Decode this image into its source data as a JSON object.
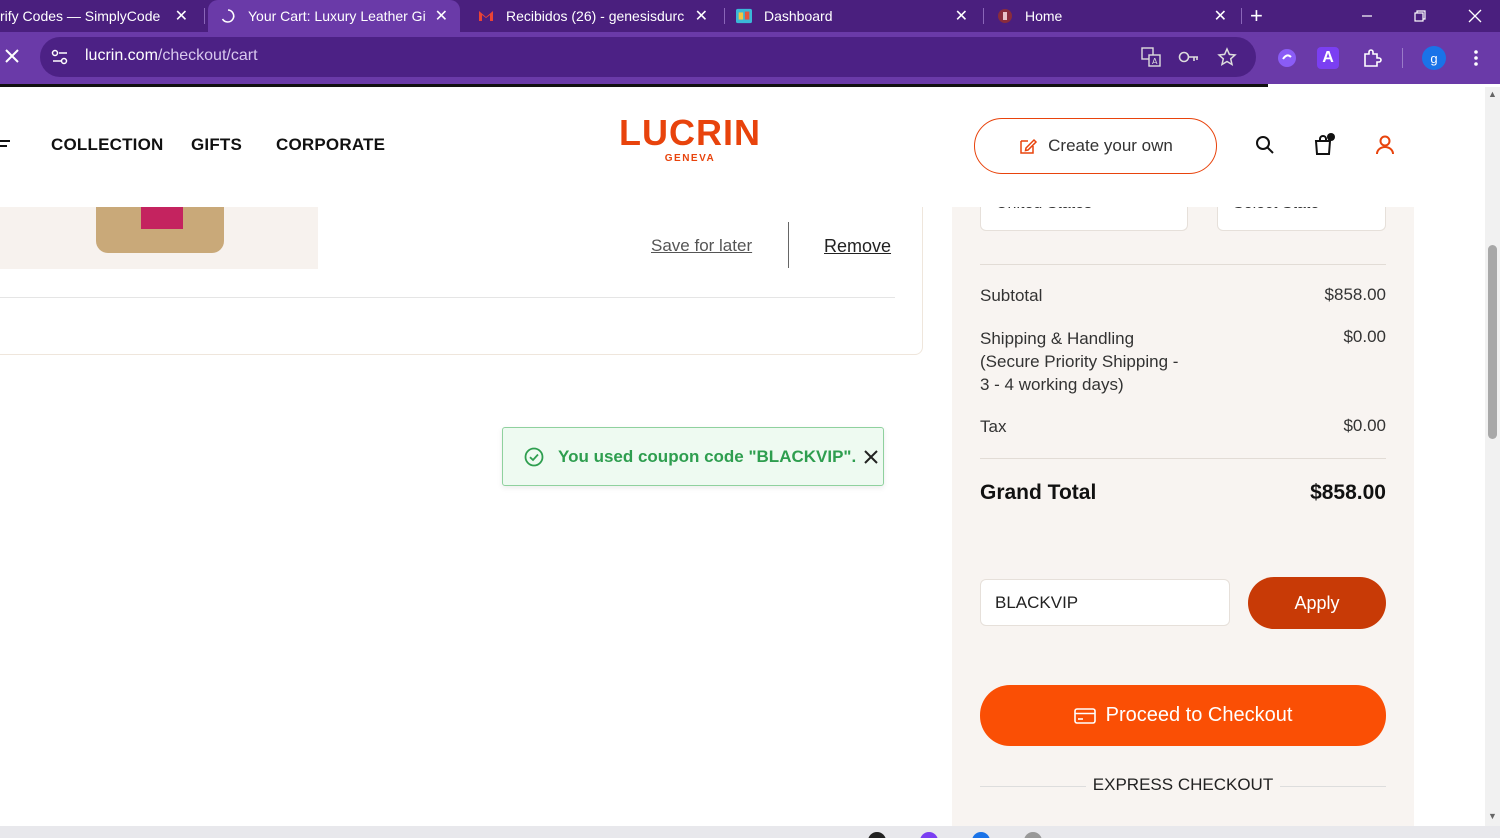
{
  "browser": {
    "tabs": [
      {
        "title": "rify Codes — SimplyCodes",
        "active": false
      },
      {
        "title": "Your Cart: Luxury Leather Gifts",
        "active": true
      },
      {
        "title": "Recibidos (26) - genesisdurc",
        "active": false
      },
      {
        "title": "Dashboard",
        "active": false
      },
      {
        "title": "Home",
        "active": false
      }
    ],
    "new_tab": "+",
    "url_domain": "lucrin.com",
    "url_path": "/checkout/cart",
    "profile_initial": "g",
    "extension_letter": "A"
  },
  "header": {
    "nav": [
      "COLLECTION",
      "GIFTS",
      "CORPORATE"
    ],
    "logo_main": "LUCRIN",
    "logo_sub": "GENEVA",
    "create_button": "Create your own"
  },
  "cart": {
    "save_for_later": "Save for later",
    "remove": "Remove"
  },
  "toast": {
    "message": "You used coupon code \"BLACKVIP\"."
  },
  "summary": {
    "country": "United States",
    "state": "Select State",
    "subtotal_label": "Subtotal",
    "subtotal_value": "$858.00",
    "shipping_label": "Shipping & Handling (Secure Priority Shipping - 3 - 4 working days)",
    "shipping_value": "$0.00",
    "tax_label": "Tax",
    "tax_value": "$0.00",
    "grand_total_label": "Grand Total",
    "grand_total_value": "$858.00",
    "coupon_value": "BLACKVIP",
    "apply_label": "Apply",
    "checkout_label": "Proceed to Checkout",
    "express_label": "EXPRESS CHECKOUT"
  },
  "colors": {
    "brand_orange": "#e8430c",
    "checkout_orange": "#fa4f05",
    "apply_red": "#c83a06",
    "success_green": "#2e9e4f",
    "chrome_purple": "#6a3aa8"
  }
}
